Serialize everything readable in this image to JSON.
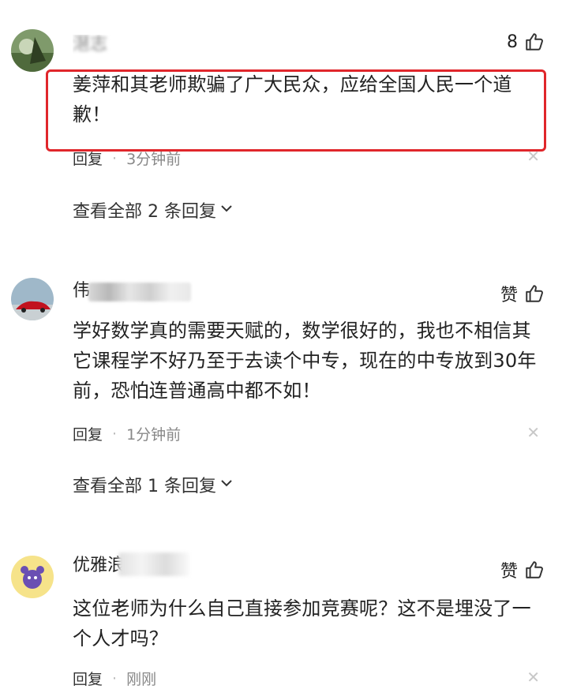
{
  "comments": [
    {
      "username": "潖志",
      "like_label": "8",
      "text": "姜萍和其老师欺骗了广大民众，应给全国人民一个道歉！",
      "reply_label": "回复",
      "time": "3分钟前",
      "view_all": "查看全部 2 条回复"
    },
    {
      "username": "伟",
      "like_label": "赞",
      "text": "学好数学真的需要天赋的，数学很好的，我也不相信其它课程学不好乃至于去读个中专，现在的中专放到30年前，恐怕连普通高中都不如！",
      "reply_label": "回复",
      "time": "1分钟前",
      "view_all": "查看全部 1 条回复"
    },
    {
      "username": "优雅浪",
      "like_label": "赞",
      "text": "这位老师为什么自己直接参加竞赛呢？这不是埋没了一个人才吗？",
      "reply_label": "回复",
      "time": "刚刚"
    }
  ],
  "icons": {
    "like": "thumbs-up-icon",
    "close": "close-icon",
    "chevron": "chevron-down-icon"
  },
  "colors": {
    "highlight": "#e0262b",
    "text": "#222222",
    "muted": "#888888"
  }
}
